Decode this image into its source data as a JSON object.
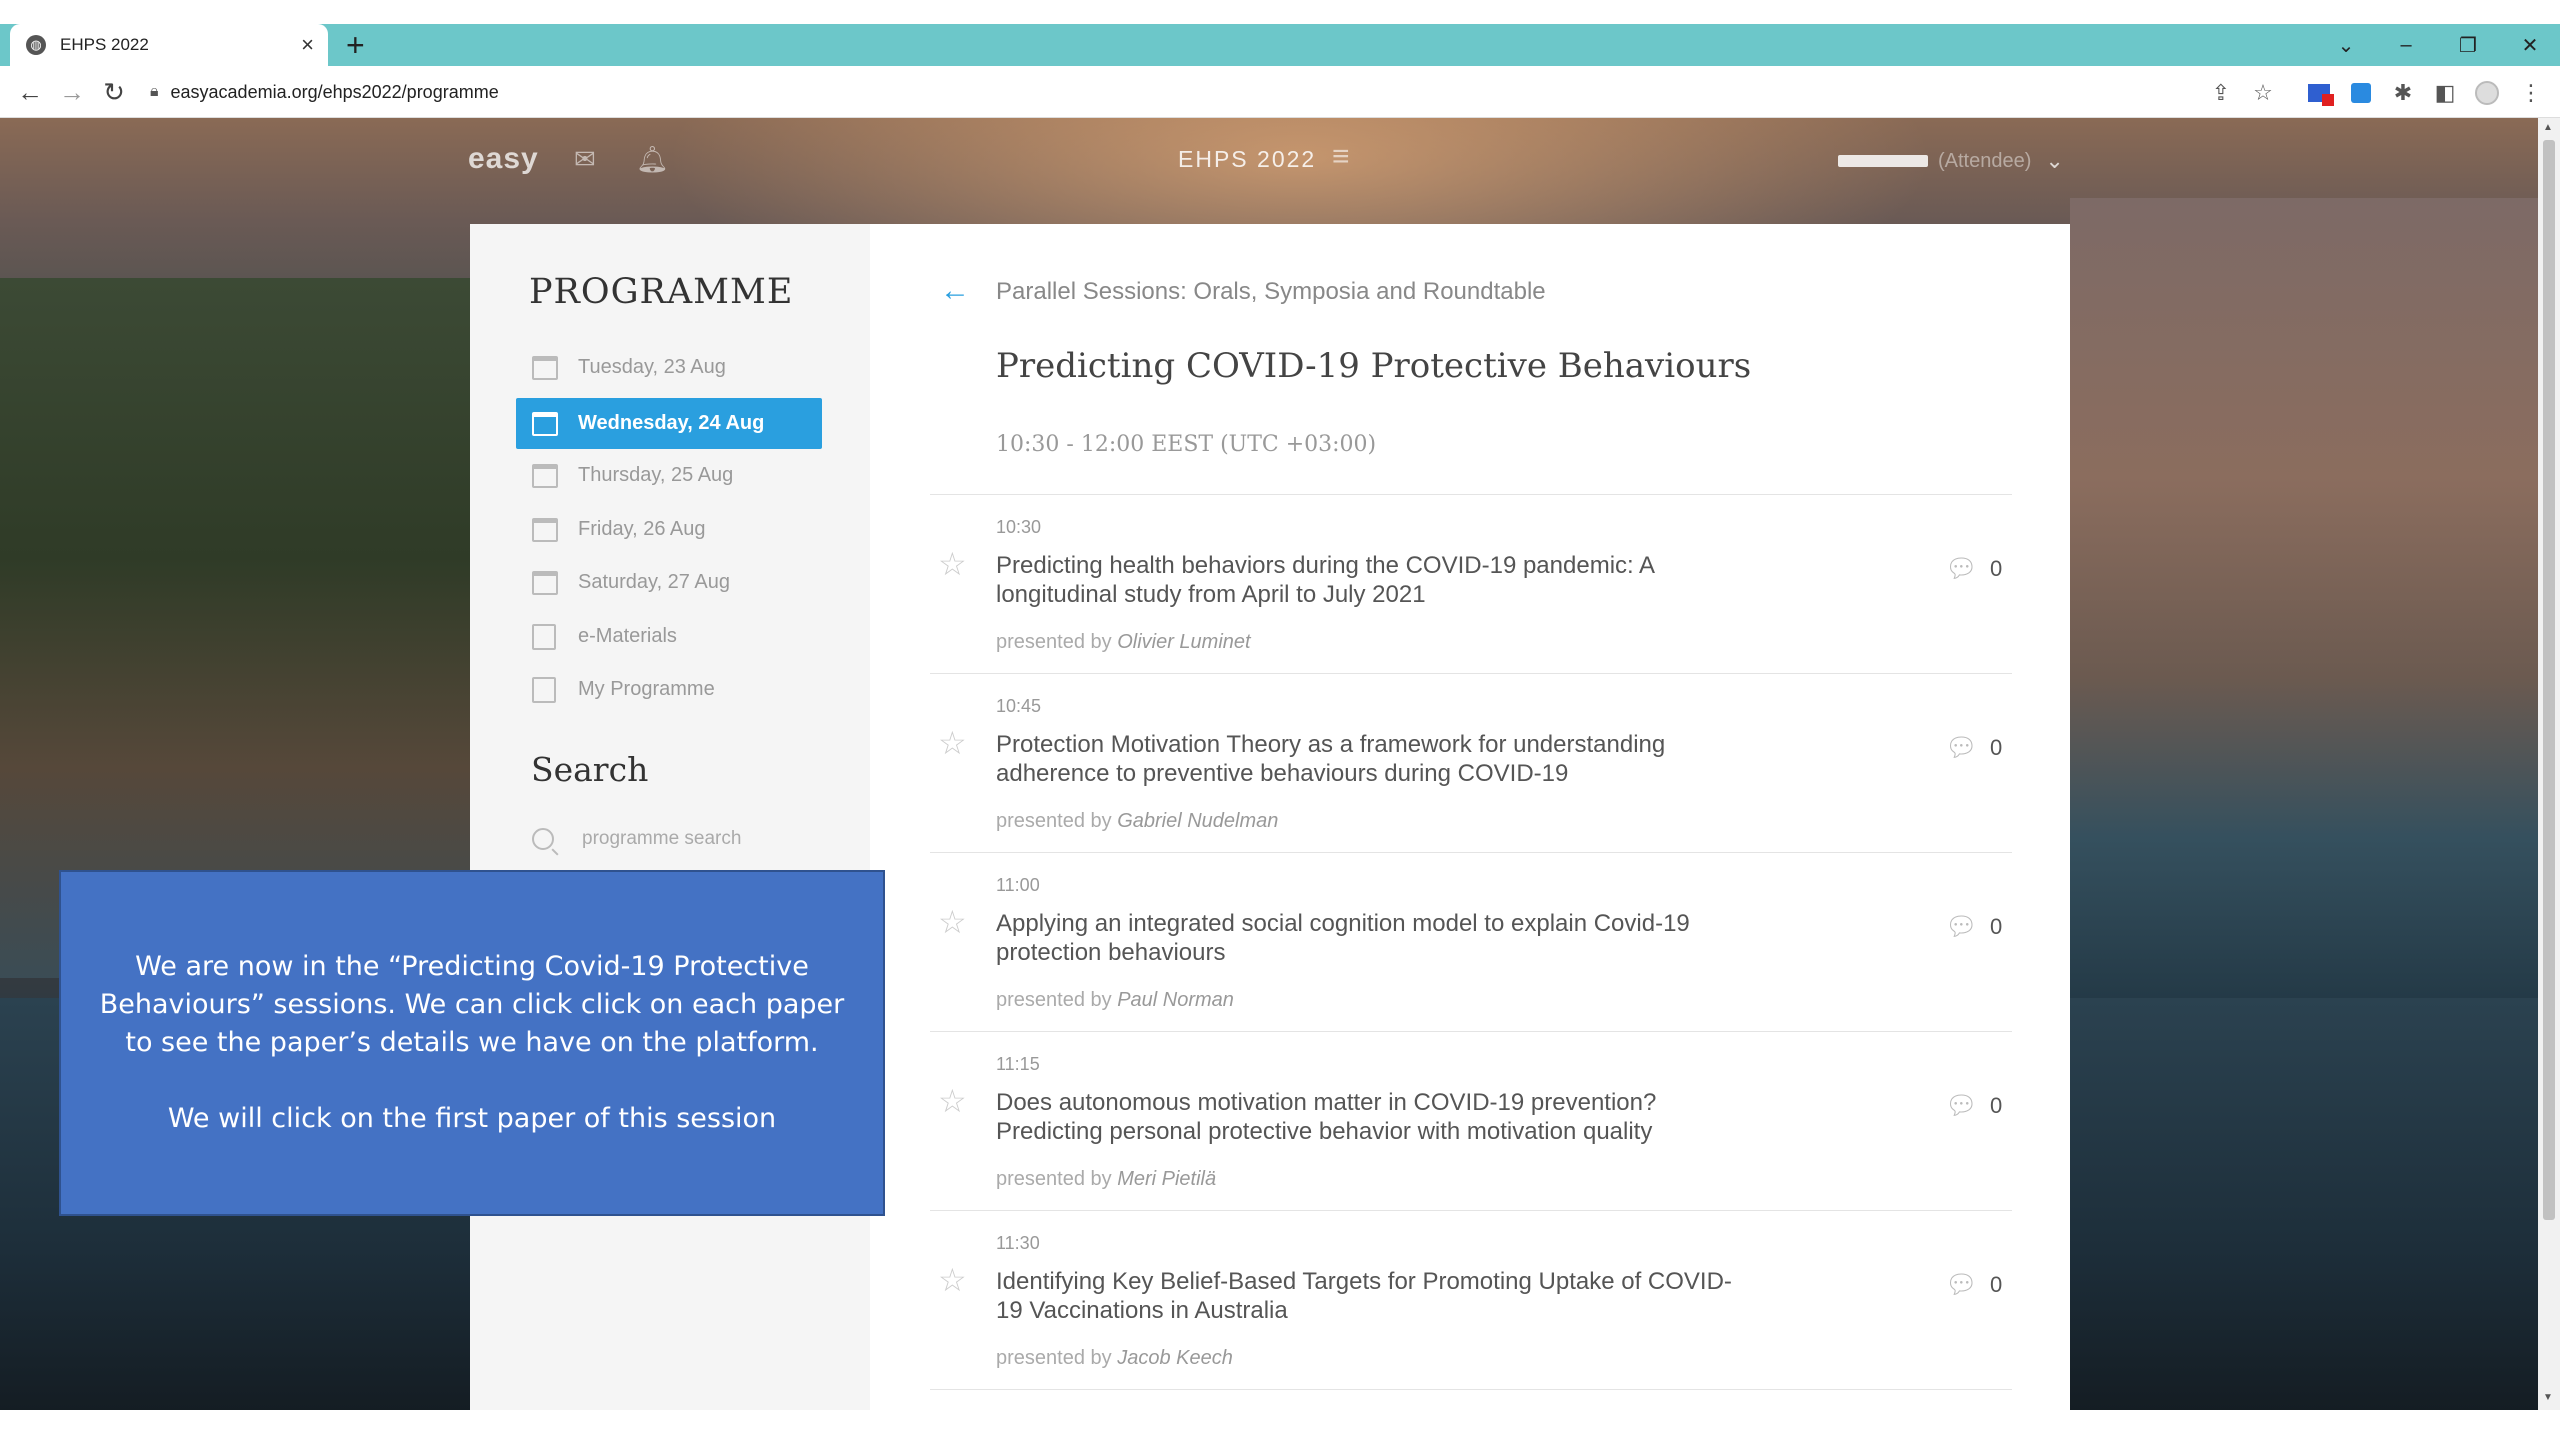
{
  "browser": {
    "tab_title": "EHPS 2022",
    "tab_close": "×",
    "new_tab": "+",
    "url": "easyacademia.org/ehps2022/programme",
    "win_min": "–",
    "win_restore": "❐",
    "win_close": "✕",
    "win_chevron": "⌄"
  },
  "header": {
    "logo": "easy",
    "event_title": "EHPS 2022",
    "user_role": "(Attendee)"
  },
  "sidebar": {
    "title": "PROGRAMME",
    "days": [
      {
        "label": "Tuesday, 23 Aug",
        "active": false
      },
      {
        "label": "Wednesday, 24 Aug",
        "active": true
      },
      {
        "label": "Thursday, 25 Aug",
        "active": false
      },
      {
        "label": "Friday, 26 Aug",
        "active": false
      },
      {
        "label": "Saturday, 27 Aug",
        "active": false
      }
    ],
    "ematerials": "e-Materials",
    "my_programme": "My Programme",
    "search_title": "Search",
    "search_placeholder": "programme search"
  },
  "main": {
    "breadcrumb": "Parallel Sessions: Orals, Symposia and Roundtable",
    "session_title": "Predicting COVID-19 Protective Behaviours",
    "session_time": "10:30 - 12:00 EEST (UTC +03:00)",
    "presented_by": "presented by",
    "papers": [
      {
        "time": "10:30",
        "title": "Predicting health behaviors during the COVID-19 pandemic: A longitudinal study from April to July 2021",
        "presenter": "Olivier Luminet",
        "comments": "0"
      },
      {
        "time": "10:45",
        "title": "Protection Motivation Theory as a framework for understanding adherence to preventive behaviours during COVID-19",
        "presenter": "Gabriel Nudelman",
        "comments": "0"
      },
      {
        "time": "11:00",
        "title": "Applying an integrated social cognition model to explain Covid-19 protection behaviours",
        "presenter": "Paul Norman",
        "comments": "0"
      },
      {
        "time": "11:15",
        "title": "Does autonomous motivation matter in COVID-19 prevention? Predicting personal protective behavior with motivation quality",
        "presenter": "Meri Pietilä",
        "comments": "0"
      },
      {
        "time": "11:30",
        "title": "Identifying Key Belief-Based Targets for Promoting Uptake of COVID-19 Vaccinations in Australia",
        "presenter": "Jacob Keech",
        "comments": "0"
      }
    ]
  },
  "callout": {
    "line1": "We are now in the “Predicting Covid-19 Protective Behaviours” sessions. We can click click on each paper to see the paper’s details we have on the platform.",
    "line2": "We will click on the first paper of this session"
  },
  "icons": {
    "favicon": "globe-icon",
    "back": "arrow-left-icon",
    "forward": "arrow-right-icon",
    "reload": "reload-icon",
    "lock": "lock-icon",
    "share": "share-icon",
    "bookmark": "star-icon",
    "extensions": "puzzle-icon",
    "side_panel": "side-panel-icon",
    "profile": "profile-icon",
    "more": "kebab-icon",
    "mail": "envelope-icon",
    "bell": "bell-icon",
    "menu": "hamburger-icon",
    "chevron": "chevron-down-icon",
    "calendar": "calendar-icon",
    "comment": "comment-icon",
    "favourite": "star-outline-icon"
  },
  "colors": {
    "tabstrip": "#6cc7c9",
    "accent": "#2a9fdf",
    "callout": "#4472c4"
  }
}
